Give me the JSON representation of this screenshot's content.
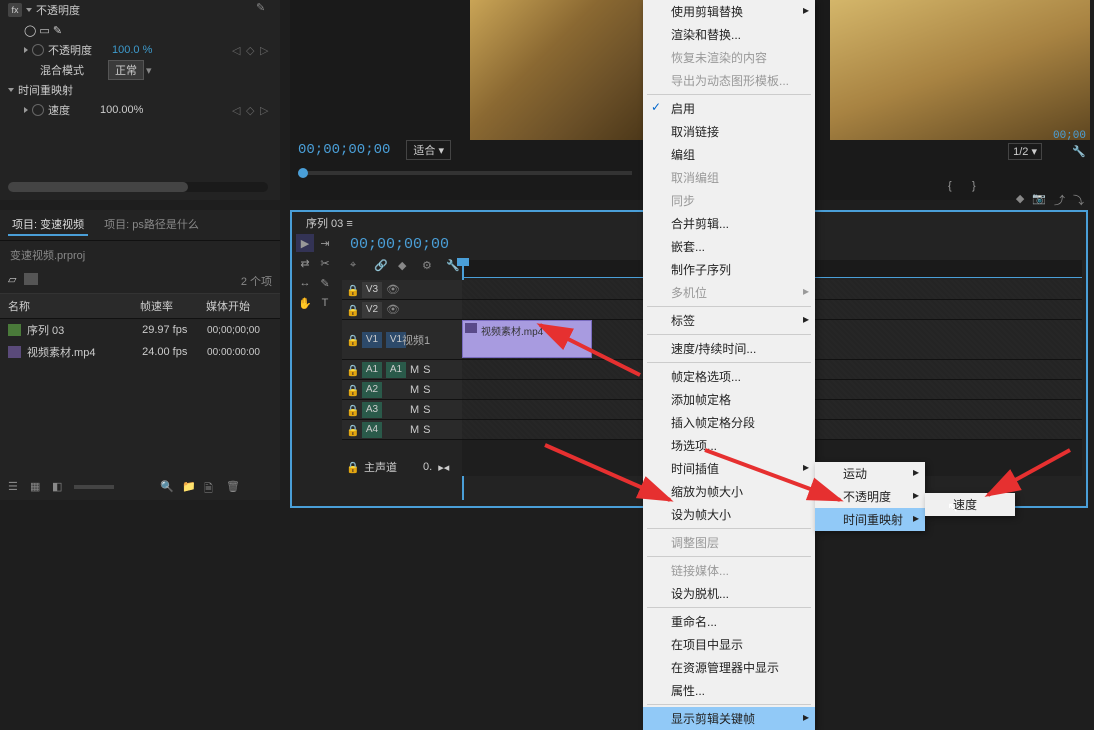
{
  "effect_controls": {
    "fx_label": "fx",
    "opacity_group": "不透明度",
    "opacity_prop": "不透明度",
    "opacity_value": "100.0 %",
    "blend_mode_label": "混合模式",
    "blend_mode_value": "正常",
    "time_remap_group": "时间重映射",
    "speed_prop": "速度",
    "speed_value": "100.00%"
  },
  "monitor": {
    "timecode": "00;00;00;00",
    "fit_label": "适合",
    "zoom_value": "1/2",
    "right_timecode": "00;00"
  },
  "project": {
    "tab1": "项目: 变速视频",
    "tab2": "项目: ps路径是什么",
    "file": "变速视频.prproj",
    "item_count": "2 个项",
    "col_name": "名称",
    "col_fps": "帧速率",
    "col_start": "媒体开始",
    "rows": [
      {
        "name": "序列 03",
        "fps": "29.97 fps",
        "start": "00;00;00;00"
      },
      {
        "name": "视频素材.mp4",
        "fps": "24.00 fps",
        "start": "00:00:00:00"
      }
    ]
  },
  "timeline": {
    "tab": "序列 03",
    "timecode": "00;00;00;00",
    "v3": "V3",
    "v2": "V2",
    "v1": "V1",
    "video1_label": "视频1",
    "a1": "A1",
    "a2": "A2",
    "a3": "A3",
    "a4": "A4",
    "mix": "M",
    "solo": "S",
    "master": "主声道",
    "clip_name": "视频素材.mp4",
    "db": "0."
  },
  "context_menu": {
    "items": [
      "使用剪辑替换",
      "渲染和替换...",
      "恢复未渲染的内容",
      "导出为动态图形模板...",
      "启用",
      "取消链接",
      "编组",
      "取消编组",
      "同步",
      "合并剪辑...",
      "嵌套...",
      "制作子序列",
      "多机位",
      "标签",
      "速度/持续时间...",
      "帧定格选项...",
      "添加帧定格",
      "插入帧定格分段",
      "场选项...",
      "时间插值",
      "缩放为帧大小",
      "设为帧大小",
      "调整图层",
      "链接媒体...",
      "设为脱机...",
      "重命名...",
      "在项目中显示",
      "在资源管理器中显示",
      "属性...",
      "显示剪辑关键帧"
    ],
    "submenu1": [
      "运动",
      "不透明度",
      "时间重映射"
    ],
    "submenu2": [
      "速度"
    ]
  }
}
